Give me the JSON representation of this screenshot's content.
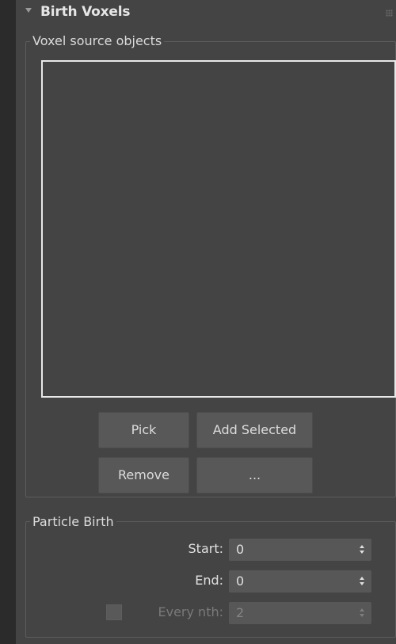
{
  "rollout": {
    "title": "Birth Voxels",
    "collapse_icon": "triangle-down-icon"
  },
  "voxel_source": {
    "group_title": "Voxel source objects",
    "list_items": [],
    "buttons": {
      "pick": "Pick",
      "add_selected": "Add Selected",
      "remove": "Remove",
      "more": "..."
    }
  },
  "particle_birth": {
    "group_title": "Particle Birth",
    "start": {
      "label": "Start:",
      "value": "0"
    },
    "end": {
      "label": "End:",
      "value": "0"
    },
    "every_nth": {
      "label": "Every nth:",
      "value": "2",
      "checked": false,
      "enabled": false
    }
  },
  "colors": {
    "panel_bg": "#444444",
    "button_bg": "#585858",
    "spinner_bg": "#575757",
    "list_border": "#e8e8e8",
    "text": "#dcdcdc",
    "disabled_text": "#7a7a7a"
  }
}
